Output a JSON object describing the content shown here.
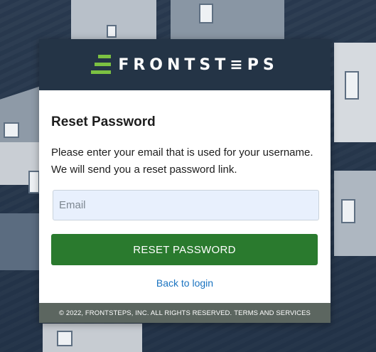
{
  "brand": {
    "logo_text": "FRONTST≡PS",
    "header_bg": "#243446",
    "accent": "#7cc142"
  },
  "form": {
    "title": "Reset Password",
    "description": "Please enter your email that is used for your username. We will send you a reset password link.",
    "email_placeholder": "Email",
    "email_value": "",
    "submit_label": "RESET PASSWORD",
    "submit_color": "#2a7a2e",
    "back_link_label": "Back to login"
  },
  "footer": {
    "copyright": "© 2022, FRONTSTEPS, INC. ALL RIGHTS RESERVED.",
    "terms_link": "TERMS AND SERVICES"
  }
}
